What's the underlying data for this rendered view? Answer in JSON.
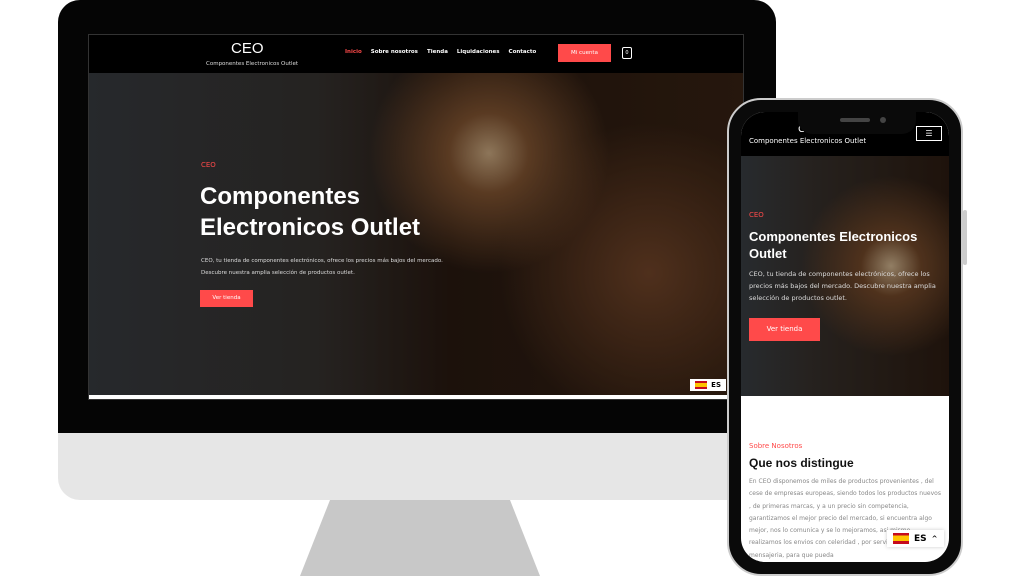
{
  "site": {
    "logo": "CEO",
    "tagline": "Componentes Electronicos Outlet"
  },
  "nav": {
    "items": [
      "Inicio",
      "Sobre nosotros",
      "Tienda",
      "Liquidaciones",
      "Contacto"
    ],
    "active": "Inicio",
    "account": "Mi cuenta",
    "cart_count": "0"
  },
  "hero": {
    "tag": "CEO",
    "title": "Componentes Electronicos Outlet",
    "description": "CEO, tu tienda de componentes electrónicos, ofrece los precios más bajos del mercado. Descubre nuestra amplia selección de productos outlet.",
    "button": "Ver tienda"
  },
  "language": {
    "code": "ES",
    "flag": "spain-flag-icon"
  },
  "about": {
    "tag": "Sobre Nosotros",
    "title": "Que nos distingue",
    "text": "En CEO disponemos de miles de productos provenientes , del cese de empresas europeas, siendo todos los productos nuevos , de primeras marcas, y a un precio sin competencia, garantizamos el mejor precio del mercado, si encuentra algo mejor, nos lo comunica y se lo mejoramos, asi mismo realizamos los envios con celeridad , por servicios de mensajeria, para que pueda"
  },
  "colors": {
    "accent": "#ff4a4a",
    "header": "#000000"
  }
}
